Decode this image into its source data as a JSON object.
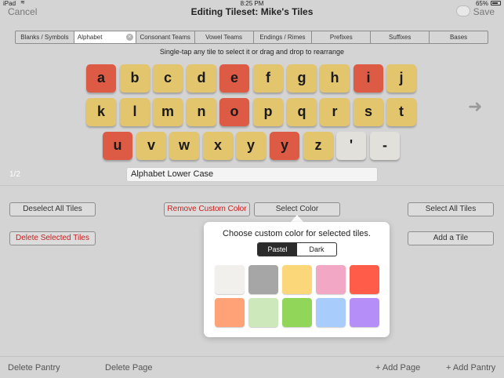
{
  "status": {
    "device": "iPad",
    "time": "8:25 PM",
    "battery": "65%"
  },
  "nav": {
    "cancel": "Cancel",
    "title": "Editing Tileset: Mike's Tiles",
    "save": "Save"
  },
  "tabs": [
    {
      "label": "Blanks / Symbols",
      "active": false
    },
    {
      "label": "Alphabet",
      "active": true
    },
    {
      "label": "Consonant Teams",
      "active": false
    },
    {
      "label": "Vowel Teams",
      "active": false
    },
    {
      "label": "Endings / Rimes",
      "active": false
    },
    {
      "label": "Prefixes",
      "active": false
    },
    {
      "label": "Suffixes",
      "active": false
    },
    {
      "label": "Bases",
      "active": false
    }
  ],
  "instructions": "Single-tap any tile to select it or drag and drop to rearrange",
  "tiles": [
    {
      "letter": "a",
      "color": "#dd5a45"
    },
    {
      "letter": "b",
      "color": "#e3c56d"
    },
    {
      "letter": "c",
      "color": "#e3c56d"
    },
    {
      "letter": "d",
      "color": "#e3c56d"
    },
    {
      "letter": "e",
      "color": "#dd5a45"
    },
    {
      "letter": "f",
      "color": "#e3c56d"
    },
    {
      "letter": "g",
      "color": "#e3c56d"
    },
    {
      "letter": "h",
      "color": "#e3c56d"
    },
    {
      "letter": "i",
      "color": "#dd5a45"
    },
    {
      "letter": "j",
      "color": "#e3c56d"
    },
    {
      "letter": "k",
      "color": "#e3c56d"
    },
    {
      "letter": "l",
      "color": "#e3c56d"
    },
    {
      "letter": "m",
      "color": "#e3c56d"
    },
    {
      "letter": "n",
      "color": "#e3c56d"
    },
    {
      "letter": "o",
      "color": "#dd5a45"
    },
    {
      "letter": "p",
      "color": "#e3c56d"
    },
    {
      "letter": "q",
      "color": "#e3c56d"
    },
    {
      "letter": "r",
      "color": "#e3c56d"
    },
    {
      "letter": "s",
      "color": "#e3c56d"
    },
    {
      "letter": "t",
      "color": "#e3c56d"
    },
    {
      "letter": "u",
      "color": "#dd5a45"
    },
    {
      "letter": "v",
      "color": "#e3c56d"
    },
    {
      "letter": "w",
      "color": "#e3c56d"
    },
    {
      "letter": "x",
      "color": "#e3c56d"
    },
    {
      "letter": "y",
      "color": "#e3c56d"
    },
    {
      "letter": "y",
      "color": "#dd5a45"
    },
    {
      "letter": "z",
      "color": "#e3c56d"
    },
    {
      "letter": "'",
      "color": "#e2e0da"
    },
    {
      "letter": "-",
      "color": "#e2e0da"
    }
  ],
  "page_indicator": "1/2",
  "tileset_name": "Alphabet Lower Case",
  "buttons": {
    "deselect_all": "Deselect All Tiles",
    "remove_custom_color": "Remove Custom Color",
    "select_color": "Select Color",
    "select_all": "Select All Tiles",
    "delete_selected": "Delete Selected Tiles",
    "add_tile": "Add a Tile"
  },
  "popover": {
    "title": "Choose custom color for selected tiles.",
    "segments": [
      {
        "label": "Pastel",
        "active": true
      },
      {
        "label": "Dark",
        "active": false
      }
    ],
    "swatches": [
      "#f2f0ec",
      "#a6a6a6",
      "#fcd77a",
      "#f2a7c4",
      "#ff5c4a",
      "#ffa278",
      "#cde9bb",
      "#92d659",
      "#a8cdfc",
      "#b68ef8"
    ]
  },
  "bottom": {
    "delete_pantry": "Delete Pantry",
    "delete_page": "Delete Page",
    "add_page": "+ Add Page",
    "add_pantry": "+ Add Pantry"
  }
}
